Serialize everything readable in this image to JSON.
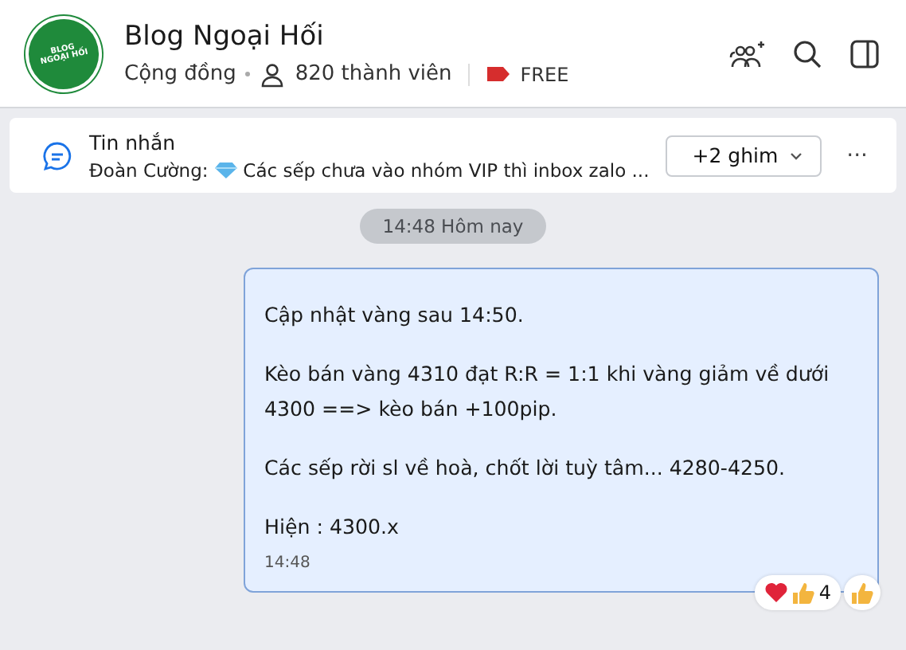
{
  "header": {
    "logo_text": [
      "BLOG",
      "NGOẠI HỐI"
    ],
    "title": "Blog Ngoại Hối",
    "type": "Cộng đồng",
    "members": "820 thành viên",
    "badge": "FREE"
  },
  "pinned": {
    "label": "Tin nhắn",
    "sender": "Đoàn Cường:",
    "text": "Các sếp chưa vào nhóm VIP thì inbox zalo ...",
    "more_button": "+2 ghim",
    "menu": "···"
  },
  "date_divider": "14:48 Hôm nay",
  "message": {
    "paragraphs": [
      "Cập nhật vàng sau 14:50.",
      "Kèo bán vàng 4310 đạt R:R = 1:1 khi vàng giảm về dưới 4300 ==> kèo bán +100pip.",
      "Các sếp rời sl về hoà, chốt lời tuỳ tâm... 4280-4250.",
      "Hiện : 4300.x"
    ],
    "time": "14:48",
    "reaction_count": "4"
  }
}
